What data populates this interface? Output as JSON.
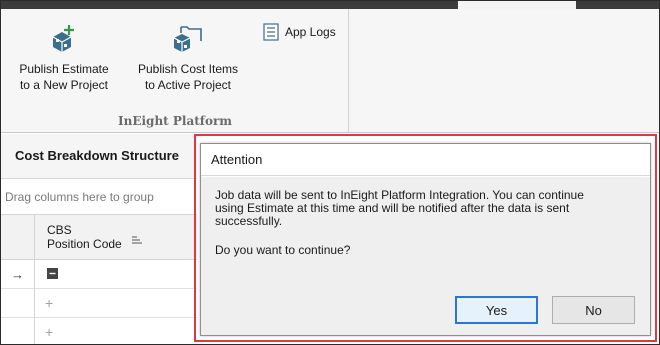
{
  "ribbon": {
    "publish_new": {
      "line1": "Publish Estimate",
      "line2": "to a New Project",
      "icon": "project-add-icon"
    },
    "publish_active": {
      "line1": "Publish Cost Items",
      "line2": "to Active Project",
      "icon": "folder-project-icon"
    },
    "app_logs": {
      "label": "App Logs",
      "icon": "list-document-icon"
    },
    "group_label": "InEight Platform"
  },
  "grid": {
    "title": "Cost Breakdown Structure",
    "group_panel": "Drag columns here to group",
    "column": {
      "line1": "CBS",
      "line2": "Position Code"
    },
    "rows": [
      {
        "indicator": "→",
        "expander": "collapse"
      },
      {
        "indicator": "",
        "expander": "+"
      },
      {
        "indicator": "",
        "expander": "+"
      }
    ]
  },
  "dialog": {
    "title": "Attention",
    "message": "Job data will be sent to InEight Platform Integration. You can continue using Estimate at this time and will be notified after the data is sent successfully.",
    "question": "Do you want to continue?",
    "yes_label": "Yes",
    "no_label": "No"
  },
  "colors": {
    "highlight": "#e0383e",
    "primary_button_border": "#2a76d2"
  }
}
